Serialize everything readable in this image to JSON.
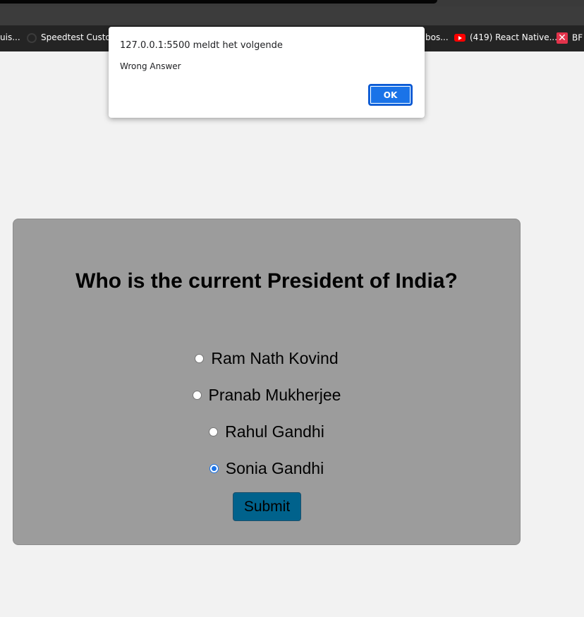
{
  "browser": {
    "bookmarks": [
      {
        "label": "uis...",
        "icon": null
      },
      {
        "label": "Speedtest Custom",
        "icon": "speedtest-icon"
      },
      {
        "label": "bos...",
        "icon": null
      },
      {
        "label": "(419) React Native...",
        "icon": "youtube-icon"
      },
      {
        "label": "BF",
        "icon": "x-logo-icon"
      }
    ]
  },
  "alert": {
    "title": "127.0.0.1:5500 meldt het volgende",
    "message": "Wrong Answer",
    "ok_label": "OK"
  },
  "quiz": {
    "question": "Who is the current President of India?",
    "options": [
      {
        "label": "Ram Nath Kovind",
        "checked": false
      },
      {
        "label": "Pranab Mukherjee",
        "checked": false
      },
      {
        "label": "Rahul Gandhi",
        "checked": false
      },
      {
        "label": "Sonia Gandhi",
        "checked": true
      }
    ],
    "submit_label": "Submit"
  },
  "colors": {
    "page_bg": "#f2f2f2",
    "card_bg": "#9c9c9c",
    "submit_bg": "#00628c",
    "accent": "#1a73e8"
  }
}
